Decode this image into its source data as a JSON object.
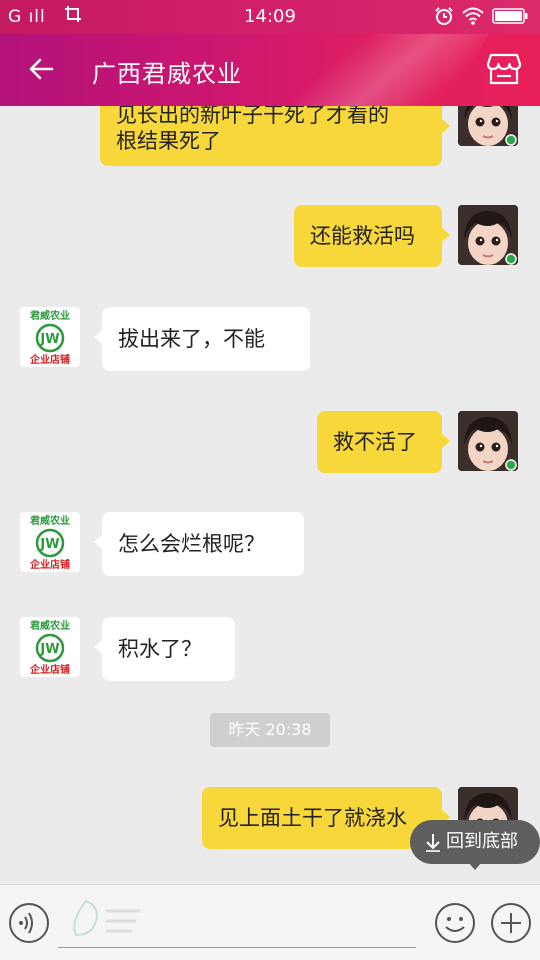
{
  "status_bar": {
    "signal_text": "G ıll",
    "time": "14:09",
    "icons": [
      "screenshot-crop-icon",
      "alarm-icon",
      "wifi-icon",
      "battery-icon"
    ]
  },
  "title_bar": {
    "title": "广西君威农业",
    "back_icon": "back-arrow-icon",
    "store_icon": "store-icon"
  },
  "shop_avatar": {
    "line_top": "君威农业",
    "monogram": "JW",
    "line_bottom": "企业店铺"
  },
  "messages": [
    {
      "from": "me",
      "lines": [
        "见长出的新叶子干死了才看的",
        "根结果死了"
      ]
    },
    {
      "from": "me",
      "lines": [
        "还能救活吗"
      ]
    },
    {
      "from": "shop",
      "lines": [
        "拔出来了，不能"
      ]
    },
    {
      "from": "me",
      "lines": [
        "救不活了"
      ]
    },
    {
      "from": "shop",
      "lines": [
        "怎么会烂根呢？"
      ]
    },
    {
      "from": "shop",
      "lines": [
        "积水了？"
      ]
    },
    {
      "from": "me",
      "lines": [
        "见上面土干了就浇水"
      ]
    }
  ],
  "timestamp": "昨天 20:38",
  "back_to_bottom": "回到底部",
  "input": {
    "value": "",
    "placeholder": ""
  },
  "colors": {
    "title_bar": "#cc1670",
    "my_bubble": "#f8d73a",
    "their_bubble": "#ffffff",
    "chat_bg": "#ebebeb"
  }
}
